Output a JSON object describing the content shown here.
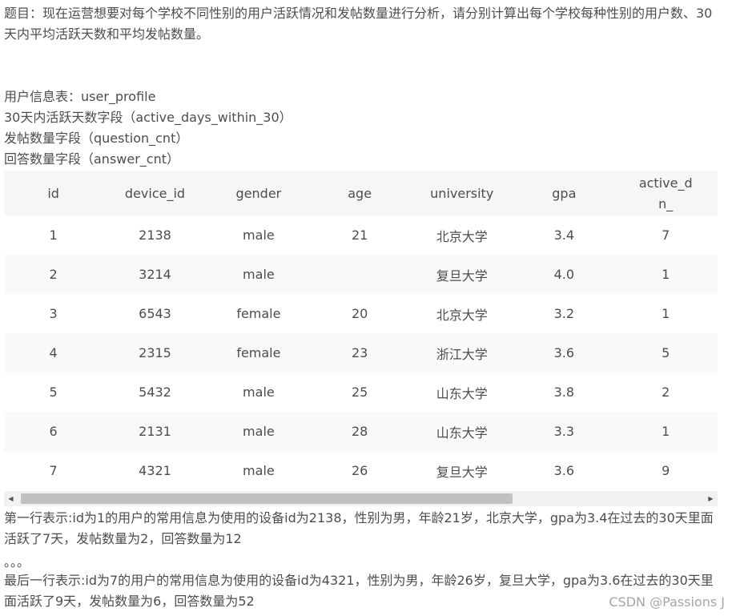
{
  "question": "题目：现在运营想要对每个学校不同性别的用户活跃情况和发帖数量进行分析，请分别计算出每个学校每种性别的用户数、30天内平均活跃天数和平均发帖数量。",
  "meta": {
    "table_name": "用户信息表：user_profile",
    "active_field": "30天内活跃天数字段（active_days_within_30）",
    "question_field": "发帖数量字段（question_cnt）",
    "answer_field": "回答数量字段（answer_cnt）"
  },
  "table": {
    "headers": [
      "id",
      "device_id",
      "gender",
      "age",
      "university",
      "gpa",
      "active_d",
      "n_"
    ],
    "rows": [
      {
        "id": "1",
        "device_id": "2138",
        "gender": "male",
        "age": "21",
        "university": "北京大学",
        "gpa": "3.4",
        "active": "7"
      },
      {
        "id": "2",
        "device_id": "3214",
        "gender": "male",
        "age": "",
        "university": "复旦大学",
        "gpa": "4.0",
        "active": "1"
      },
      {
        "id": "3",
        "device_id": "6543",
        "gender": "female",
        "age": "20",
        "university": "北京大学",
        "gpa": "3.2",
        "active": "1"
      },
      {
        "id": "4",
        "device_id": "2315",
        "gender": "female",
        "age": "23",
        "university": "浙江大学",
        "gpa": "3.6",
        "active": "5"
      },
      {
        "id": "5",
        "device_id": "5432",
        "gender": "male",
        "age": "25",
        "university": "山东大学",
        "gpa": "3.8",
        "active": "2"
      },
      {
        "id": "6",
        "device_id": "2131",
        "gender": "male",
        "age": "28",
        "university": "山东大学",
        "gpa": "3.3",
        "active": "1"
      },
      {
        "id": "7",
        "device_id": "4321",
        "gender": "male",
        "age": "26",
        "university": "复旦大学",
        "gpa": "3.6",
        "active": "9"
      }
    ]
  },
  "scrollbar": {
    "left_arrow_icon": "chevron-left-icon",
    "right_arrow_icon": "chevron-right-icon"
  },
  "notes": {
    "first_row": "第一行表示:id为1的用户的常用信息为使用的设备id为2138，性别为男，年龄21岁，北京大学，gpa为3.4在过去的30天里面活跃了7天，发帖数量为2，回答数量为12",
    "dots": "。。。",
    "last_row": "最后一行表示:id为7的用户的常用信息为使用的设备id为4321，性别为男，年龄26岁，复旦大学，gpa为3.6在过去的30天里面活跃了9天，发帖数量为6，回答数量为52"
  },
  "watermark": "CSDN @Passions J"
}
